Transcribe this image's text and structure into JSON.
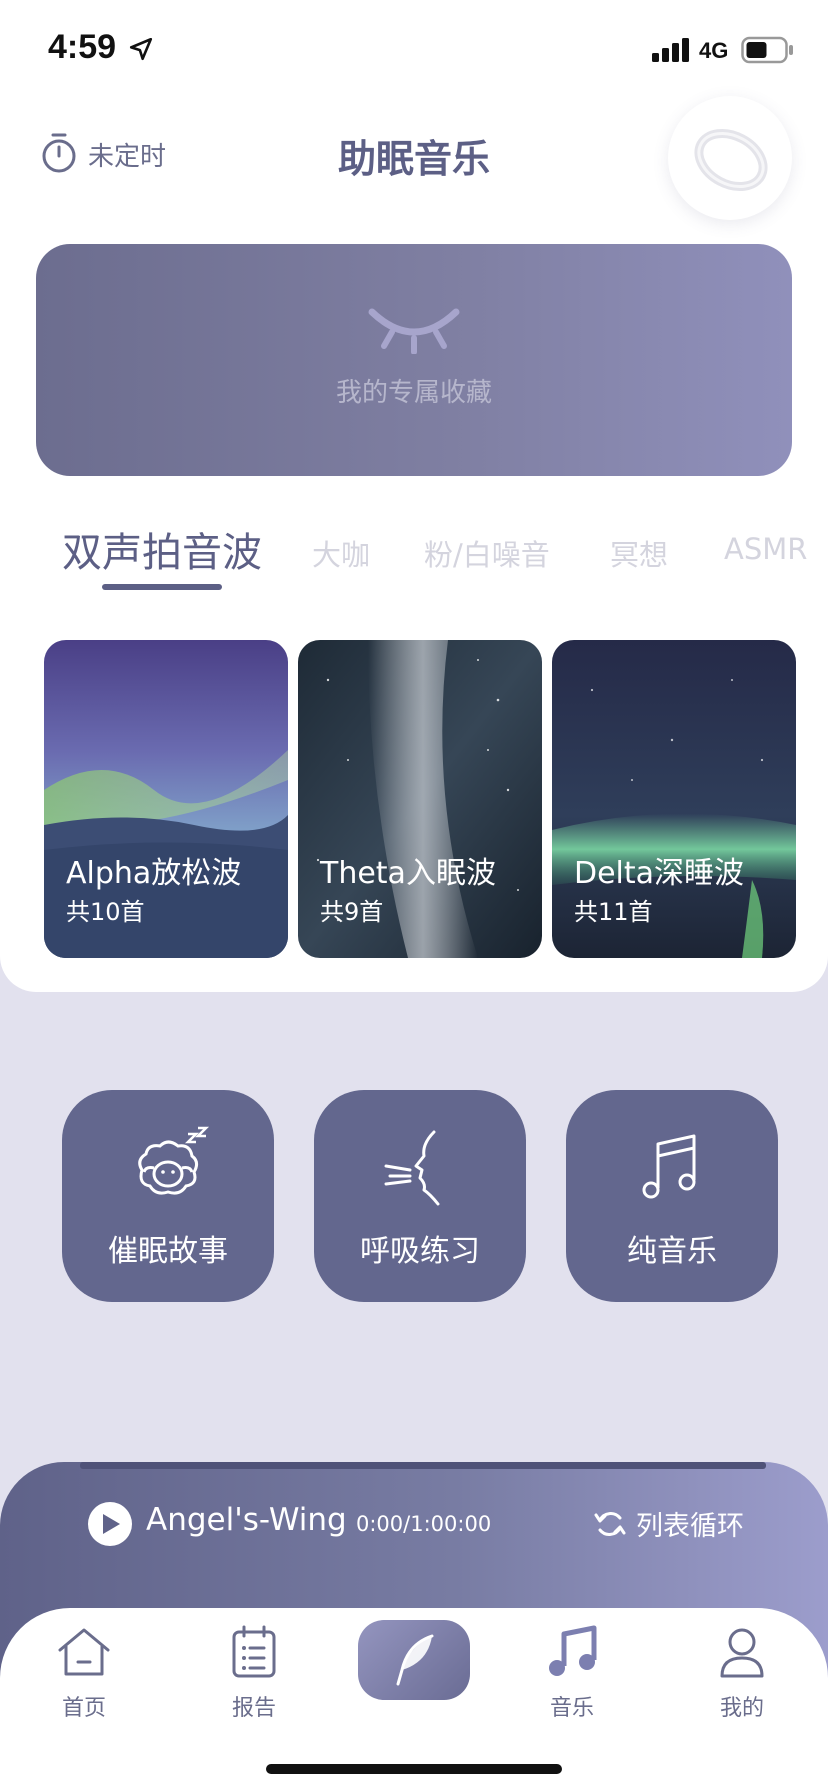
{
  "status_bar": {
    "time": "4:59",
    "network": "4G"
  },
  "header": {
    "timer_label": "未定时",
    "title": "助眠音乐"
  },
  "favorites": {
    "label": "我的专属收藏"
  },
  "categories": {
    "tabs": [
      "双声拍音波",
      "大咖",
      "粉/白噪音",
      "冥想",
      "ASMR"
    ],
    "active_index": 0
  },
  "wave_cards": [
    {
      "title": "Alpha放松波",
      "count": "共10首"
    },
    {
      "title": "Theta入眠波",
      "count": "共9首"
    },
    {
      "title": "Delta深睡波",
      "count": "共11首"
    }
  ],
  "features": [
    {
      "label": "催眠故事",
      "icon": "sheep-icon"
    },
    {
      "label": "呼吸练习",
      "icon": "breath-icon"
    },
    {
      "label": "纯音乐",
      "icon": "music-note-icon"
    }
  ],
  "player": {
    "track": "Angel's-Wing",
    "time": "0:00/1:00:00",
    "mode": "列表循环",
    "progress": 0.0
  },
  "tab_bar": {
    "items": [
      {
        "label": "首页",
        "icon": "home-icon"
      },
      {
        "label": "报告",
        "icon": "report-icon"
      },
      {
        "label": "",
        "icon": "feather-icon"
      },
      {
        "label": "音乐",
        "icon": "music-icon"
      },
      {
        "label": "我的",
        "icon": "profile-icon"
      }
    ],
    "active_index": 3
  },
  "colors": {
    "accent": "#5c5f85",
    "tile": "#63678e",
    "background": "#e2e1ee"
  }
}
